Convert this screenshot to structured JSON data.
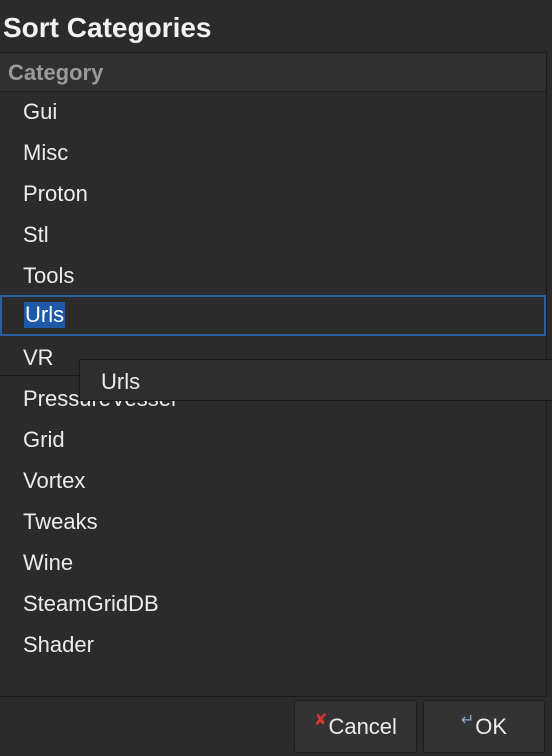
{
  "dialog": {
    "title": "Sort Categories"
  },
  "list": {
    "header": "Category",
    "items": [
      {
        "label": "Gui"
      },
      {
        "label": "Misc"
      },
      {
        "label": "Proton"
      },
      {
        "label": "Stl"
      },
      {
        "label": "Tools"
      },
      {
        "label": "Urls",
        "selected": true
      },
      {
        "label": "VR"
      },
      {
        "label": "PressureVessel"
      },
      {
        "label": "Grid"
      },
      {
        "label": "Vortex"
      },
      {
        "label": "Tweaks"
      },
      {
        "label": "Wine"
      },
      {
        "label": "SteamGridDB"
      },
      {
        "label": "Shader"
      }
    ],
    "drag_label": "Urls"
  },
  "buttons": {
    "cancel": "Cancel",
    "ok": "OK",
    "cancel_icon": "x-icon",
    "ok_icon": "enter-arrow-icon"
  },
  "colors": {
    "selection": "#1f5aa8",
    "background": "#2b2b2b",
    "cancel_icon": "#e0322c"
  }
}
